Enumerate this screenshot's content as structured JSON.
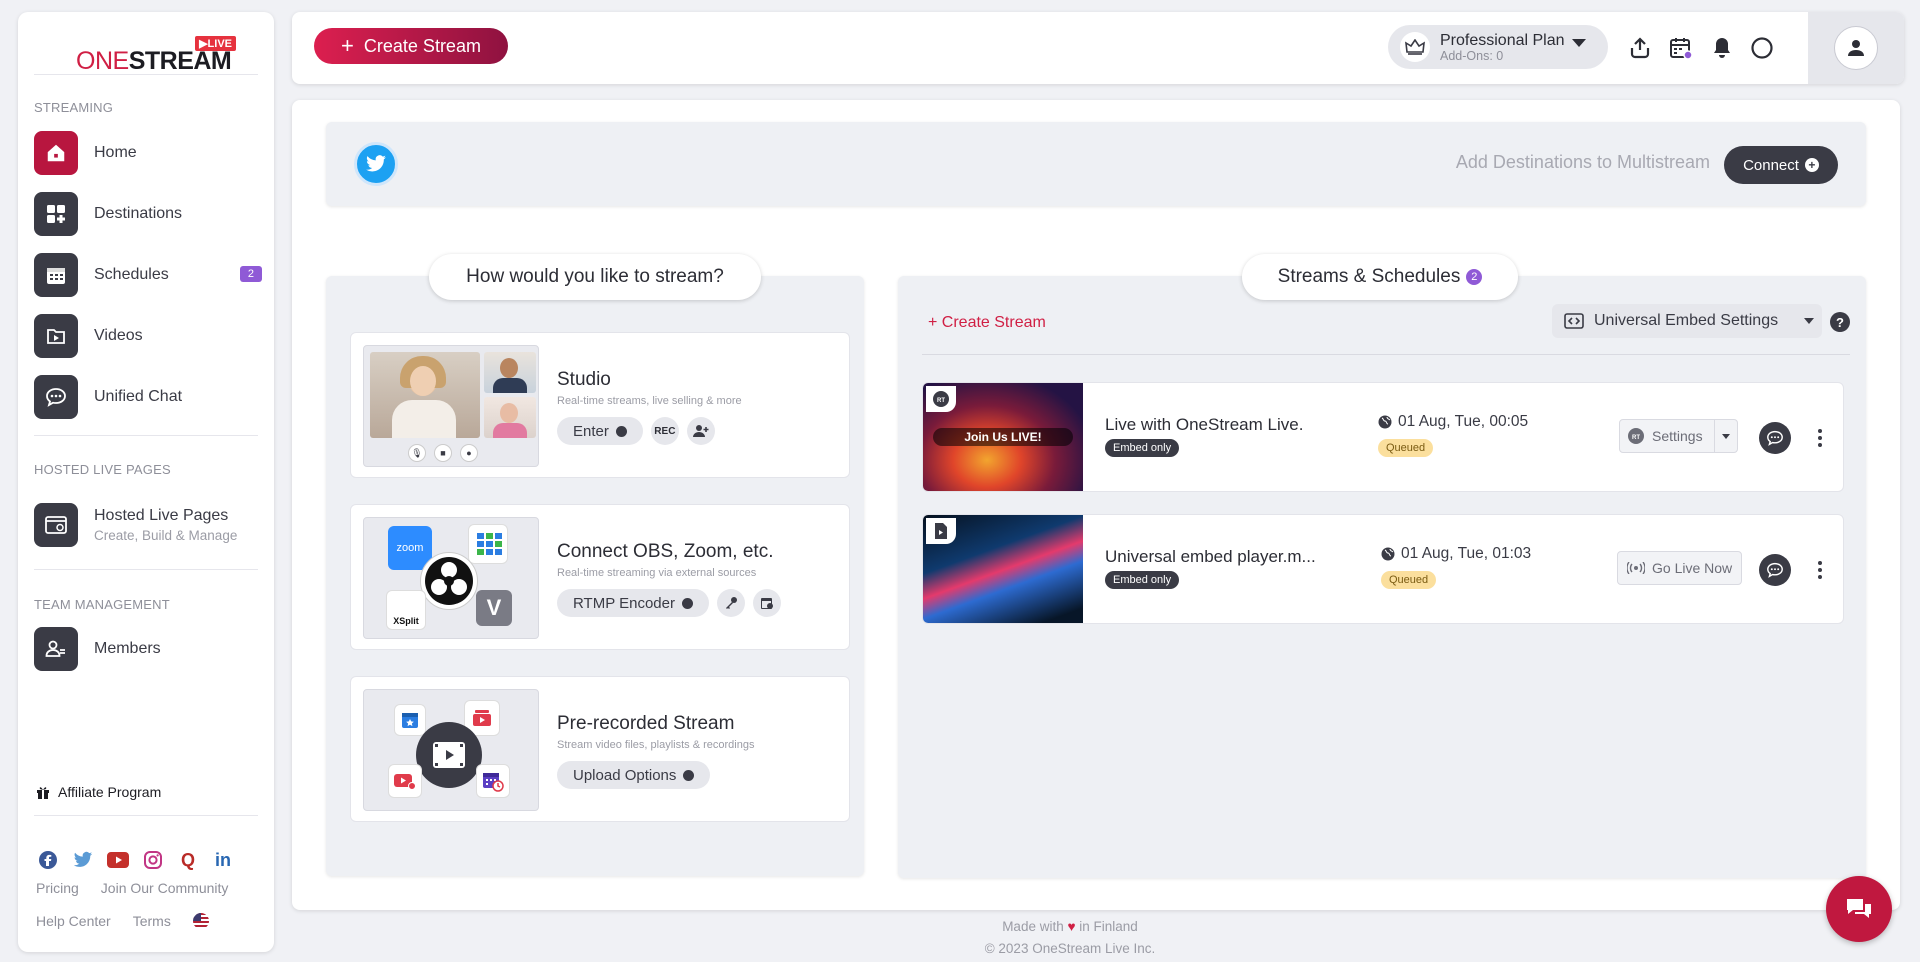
{
  "brand": {
    "name_part1": "ONE",
    "name_part2": "STREAM",
    "live_badge": "LIVE",
    "brand_color": "#d01f44"
  },
  "sidebar": {
    "sections": [
      "STREAMING",
      "HOSTED LIVE PAGES",
      "TEAM MANAGEMENT"
    ],
    "items": [
      {
        "label": "Home",
        "icon": "home-icon",
        "active": true
      },
      {
        "label": "Destinations",
        "icon": "grid-icon"
      },
      {
        "label": "Schedules",
        "icon": "calendar-icon",
        "badge": "2"
      },
      {
        "label": "Videos",
        "icon": "video-folder-icon"
      },
      {
        "label": "Unified Chat",
        "icon": "chat-icon"
      },
      {
        "label": "Hosted Live Pages",
        "sub": "Create, Build & Manage",
        "icon": "web-page-icon"
      },
      {
        "label": "Members",
        "icon": "members-icon"
      }
    ],
    "affiliate": "Affiliate Program",
    "social": [
      "facebook-icon",
      "twitter-icon",
      "youtube-icon",
      "instagram-icon",
      "quora-icon",
      "linkedin-icon"
    ],
    "links_row1": [
      "Pricing",
      "Join Our Community"
    ],
    "links_row2": [
      "Help Center",
      "Terms"
    ]
  },
  "topbar": {
    "create_label": "Create Stream",
    "plan_title": "Professional Plan",
    "plan_sub": "Add-Ons: 0"
  },
  "destinations": {
    "text": "Add Destinations to Multistream",
    "connect_label": "Connect"
  },
  "how": {
    "title": "How would you like to stream?",
    "cards": [
      {
        "title": "Studio",
        "sub": "Real-time streams, live selling & more",
        "button": "Enter",
        "extra": "REC"
      },
      {
        "title": "Connect OBS, Zoom, etc.",
        "sub": "Real-time streaming via external sources",
        "button": "RTMP Encoder",
        "zoom_label": "zoom",
        "xsplit_label": "XSplit"
      },
      {
        "title": "Pre-recorded Stream",
        "sub": "Stream video files, playlists & recordings",
        "button": "Upload Options"
      }
    ]
  },
  "streams": {
    "title": "Streams & Schedules",
    "count": "2",
    "create_link": "+ Create Stream",
    "embed_settings": "Universal Embed Settings",
    "rows": [
      {
        "name": "Live with OneStream Live.",
        "tag": "Embed only",
        "date": "01 Aug, Tue, 00:05",
        "status": "Queued",
        "action": "Settings",
        "overlay": "Join Us LIVE!"
      },
      {
        "name": "Universal embed player.m...",
        "tag": "Embed only",
        "date": "01 Aug, Tue, 01:03",
        "status": "Queued",
        "action": "Go Live Now"
      }
    ]
  },
  "footer": {
    "line1_a": "Made with",
    "heart": "♥",
    "line1_b": "in Finland",
    "line2": "© 2023 OneStream Live Inc."
  }
}
